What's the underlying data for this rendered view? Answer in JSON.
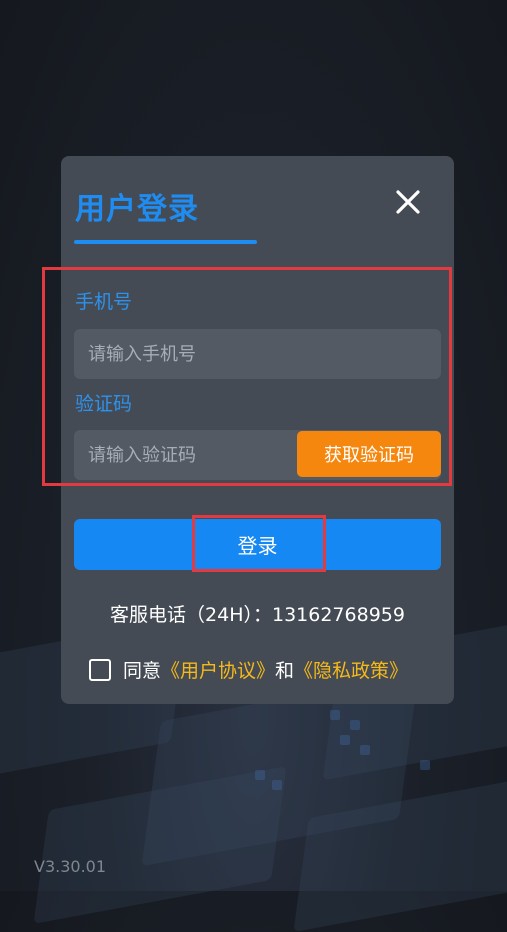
{
  "dialog": {
    "title": "用户登录",
    "close_icon": "close-icon",
    "phone_label": "手机号",
    "phone_placeholder": "请输入手机号",
    "code_label": "验证码",
    "code_placeholder": "请输入验证码",
    "get_code_label": "获取验证码",
    "login_label": "登录",
    "service_text": "客服电话（24H）：13162768959",
    "agree": {
      "prefix": "同意",
      "user_agreement": "《用户协议》",
      "conjunction": "和",
      "privacy_policy": "《隐私政策》",
      "checked": false
    }
  },
  "version": "V3.30.01",
  "colors": {
    "accent": "#1e8cf0",
    "get_code_button": "#f5870f",
    "login_button": "#1688f3",
    "link": "#f5b91a",
    "highlight": "#e23a3f",
    "dialog_bg": "#454b55"
  }
}
